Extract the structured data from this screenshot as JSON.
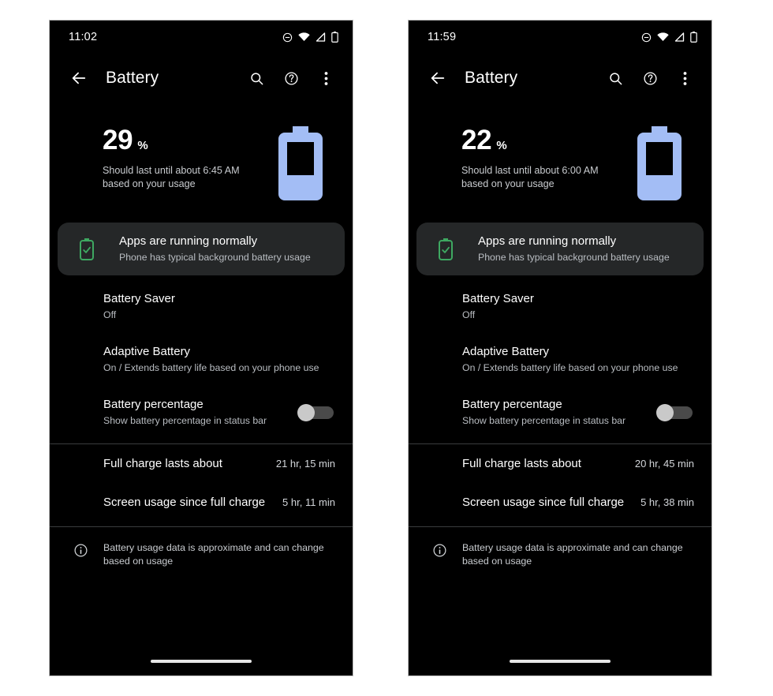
{
  "theme": {
    "page_background": "#ffffff",
    "screen_background": "#000000",
    "card_background": "#252728",
    "accent_battery": "#a3bdf5",
    "accent_status_ok": "#3ea861",
    "primary_text": "#ffffff",
    "secondary_text": "#b9bdc2",
    "divider": "#3a3c3e"
  },
  "phones": [
    {
      "id": "left",
      "statusbar": {
        "time": "11:02",
        "icons": [
          "do-not-disturb-icon",
          "wifi-icon",
          "cell-signal-icon",
          "battery-icon"
        ]
      },
      "appbar": {
        "back_label": "back-arrow",
        "title": "Battery",
        "actions": [
          "search-icon",
          "help-icon",
          "overflow-menu-icon"
        ]
      },
      "summary": {
        "percent": "29",
        "percent_sign": "%",
        "subtitle": "Should last until about 6:45 AM based on your usage",
        "battery_icon": "battery-large-icon"
      },
      "status_card": {
        "icon": "battery-check-icon",
        "title": "Apps are running normally",
        "subtitle": "Phone has typical background battery usage"
      },
      "settings_rows": [
        {
          "title": "Battery Saver",
          "subtitle": "Off",
          "has_switch": false
        },
        {
          "title": "Adaptive Battery",
          "subtitle": "On / Extends battery life based on your phone use",
          "has_switch": false
        },
        {
          "title": "Battery percentage",
          "subtitle": "Show battery percentage in status bar",
          "has_switch": true,
          "switch_on": false
        }
      ],
      "stats": [
        {
          "label": "Full charge lasts about",
          "value": "21 hr, 15 min"
        },
        {
          "label": "Screen usage since full charge",
          "value": "5 hr, 11 min"
        }
      ],
      "note": {
        "icon": "info-icon",
        "text": "Battery usage data is approximate and can change based on usage"
      }
    },
    {
      "id": "right",
      "statusbar": {
        "time": "11:59",
        "icons": [
          "do-not-disturb-icon",
          "wifi-icon",
          "cell-signal-icon",
          "battery-icon"
        ]
      },
      "appbar": {
        "back_label": "back-arrow",
        "title": "Battery",
        "actions": [
          "search-icon",
          "help-icon",
          "overflow-menu-icon"
        ]
      },
      "summary": {
        "percent": "22",
        "percent_sign": "%",
        "subtitle": "Should last until about 6:00 AM based on your usage",
        "battery_icon": "battery-large-icon"
      },
      "status_card": {
        "icon": "battery-check-icon",
        "title": "Apps are running normally",
        "subtitle": "Phone has typical background battery usage"
      },
      "settings_rows": [
        {
          "title": "Battery Saver",
          "subtitle": "Off",
          "has_switch": false
        },
        {
          "title": "Adaptive Battery",
          "subtitle": "On / Extends battery life based on your phone use",
          "has_switch": false
        },
        {
          "title": "Battery percentage",
          "subtitle": "Show battery percentage in status bar",
          "has_switch": true,
          "switch_on": false
        }
      ],
      "stats": [
        {
          "label": "Full charge lasts about",
          "value": "20 hr, 45 min"
        },
        {
          "label": "Screen usage since full charge",
          "value": "5 hr, 38 min"
        }
      ],
      "note": {
        "icon": "info-icon",
        "text": "Battery usage data is approximate and can change based on usage"
      }
    }
  ]
}
